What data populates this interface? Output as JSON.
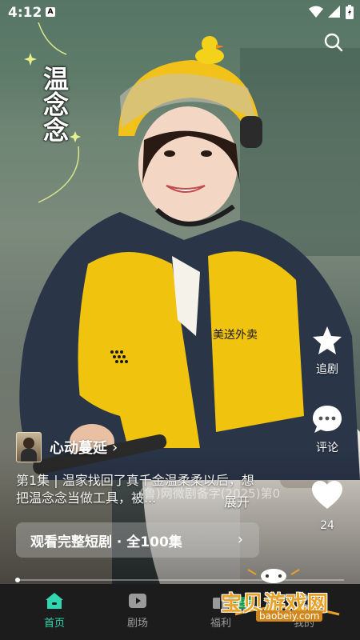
{
  "status_bar": {
    "time": "4:12",
    "notification_icon": "a-icon"
  },
  "drama": {
    "title": "温念念",
    "author_name": "心动蔓延",
    "description": "第1集 | 温家找回了真千金温柔柔以后，想把温念念当做工具，被...",
    "expand_label": "展开",
    "license_text": "(鲁)网微剧备字(2025)第0"
  },
  "side_actions": {
    "follow_label": "追剧",
    "comment_label": "评论",
    "like_count": "24"
  },
  "watch_full": {
    "label": "观看完整短剧 · 全100集"
  },
  "progress": {
    "played_fraction": 0.005
  },
  "tabs": [
    {
      "label": "首页",
      "icon": "home-icon",
      "active": true
    },
    {
      "label": "剧场",
      "icon": "play-icon",
      "active": false
    },
    {
      "label": "福利",
      "icon": "gift-icon",
      "active": false
    },
    {
      "label": "我的",
      "icon": "user-icon",
      "active": false
    }
  ],
  "watermark": {
    "text": "宝贝游戏网",
    "url": "baobeiy.com",
    "badge": "土鳖"
  },
  "colors": {
    "accent": "#2fd8b0",
    "helmet": "#f2c21a",
    "jacket": "#f0c30f",
    "jacket_dark": "#2a3548"
  }
}
